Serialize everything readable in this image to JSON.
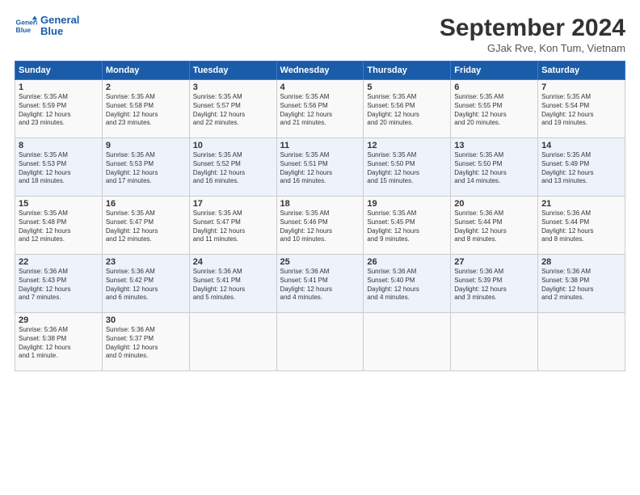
{
  "header": {
    "logo_line1": "General",
    "logo_line2": "Blue",
    "title": "September 2024",
    "subtitle": "GJak Rve, Kon Tum, Vietnam"
  },
  "days_of_week": [
    "Sunday",
    "Monday",
    "Tuesday",
    "Wednesday",
    "Thursday",
    "Friday",
    "Saturday"
  ],
  "weeks": [
    [
      {
        "day": "1",
        "lines": [
          "Sunrise: 5:35 AM",
          "Sunset: 5:59 PM",
          "Daylight: 12 hours",
          "and 23 minutes."
        ]
      },
      {
        "day": "2",
        "lines": [
          "Sunrise: 5:35 AM",
          "Sunset: 5:58 PM",
          "Daylight: 12 hours",
          "and 23 minutes."
        ]
      },
      {
        "day": "3",
        "lines": [
          "Sunrise: 5:35 AM",
          "Sunset: 5:57 PM",
          "Daylight: 12 hours",
          "and 22 minutes."
        ]
      },
      {
        "day": "4",
        "lines": [
          "Sunrise: 5:35 AM",
          "Sunset: 5:56 PM",
          "Daylight: 12 hours",
          "and 21 minutes."
        ]
      },
      {
        "day": "5",
        "lines": [
          "Sunrise: 5:35 AM",
          "Sunset: 5:56 PM",
          "Daylight: 12 hours",
          "and 20 minutes."
        ]
      },
      {
        "day": "6",
        "lines": [
          "Sunrise: 5:35 AM",
          "Sunset: 5:55 PM",
          "Daylight: 12 hours",
          "and 20 minutes."
        ]
      },
      {
        "day": "7",
        "lines": [
          "Sunrise: 5:35 AM",
          "Sunset: 5:54 PM",
          "Daylight: 12 hours",
          "and 19 minutes."
        ]
      }
    ],
    [
      {
        "day": "8",
        "lines": [
          "Sunrise: 5:35 AM",
          "Sunset: 5:53 PM",
          "Daylight: 12 hours",
          "and 18 minutes."
        ]
      },
      {
        "day": "9",
        "lines": [
          "Sunrise: 5:35 AM",
          "Sunset: 5:53 PM",
          "Daylight: 12 hours",
          "and 17 minutes."
        ]
      },
      {
        "day": "10",
        "lines": [
          "Sunrise: 5:35 AM",
          "Sunset: 5:52 PM",
          "Daylight: 12 hours",
          "and 16 minutes."
        ]
      },
      {
        "day": "11",
        "lines": [
          "Sunrise: 5:35 AM",
          "Sunset: 5:51 PM",
          "Daylight: 12 hours",
          "and 16 minutes."
        ]
      },
      {
        "day": "12",
        "lines": [
          "Sunrise: 5:35 AM",
          "Sunset: 5:50 PM",
          "Daylight: 12 hours",
          "and 15 minutes."
        ]
      },
      {
        "day": "13",
        "lines": [
          "Sunrise: 5:35 AM",
          "Sunset: 5:50 PM",
          "Daylight: 12 hours",
          "and 14 minutes."
        ]
      },
      {
        "day": "14",
        "lines": [
          "Sunrise: 5:35 AM",
          "Sunset: 5:49 PM",
          "Daylight: 12 hours",
          "and 13 minutes."
        ]
      }
    ],
    [
      {
        "day": "15",
        "lines": [
          "Sunrise: 5:35 AM",
          "Sunset: 5:48 PM",
          "Daylight: 12 hours",
          "and 12 minutes."
        ]
      },
      {
        "day": "16",
        "lines": [
          "Sunrise: 5:35 AM",
          "Sunset: 5:47 PM",
          "Daylight: 12 hours",
          "and 12 minutes."
        ]
      },
      {
        "day": "17",
        "lines": [
          "Sunrise: 5:35 AM",
          "Sunset: 5:47 PM",
          "Daylight: 12 hours",
          "and 11 minutes."
        ]
      },
      {
        "day": "18",
        "lines": [
          "Sunrise: 5:35 AM",
          "Sunset: 5:46 PM",
          "Daylight: 12 hours",
          "and 10 minutes."
        ]
      },
      {
        "day": "19",
        "lines": [
          "Sunrise: 5:35 AM",
          "Sunset: 5:45 PM",
          "Daylight: 12 hours",
          "and 9 minutes."
        ]
      },
      {
        "day": "20",
        "lines": [
          "Sunrise: 5:36 AM",
          "Sunset: 5:44 PM",
          "Daylight: 12 hours",
          "and 8 minutes."
        ]
      },
      {
        "day": "21",
        "lines": [
          "Sunrise: 5:36 AM",
          "Sunset: 5:44 PM",
          "Daylight: 12 hours",
          "and 8 minutes."
        ]
      }
    ],
    [
      {
        "day": "22",
        "lines": [
          "Sunrise: 5:36 AM",
          "Sunset: 5:43 PM",
          "Daylight: 12 hours",
          "and 7 minutes."
        ]
      },
      {
        "day": "23",
        "lines": [
          "Sunrise: 5:36 AM",
          "Sunset: 5:42 PM",
          "Daylight: 12 hours",
          "and 6 minutes."
        ]
      },
      {
        "day": "24",
        "lines": [
          "Sunrise: 5:36 AM",
          "Sunset: 5:41 PM",
          "Daylight: 12 hours",
          "and 5 minutes."
        ]
      },
      {
        "day": "25",
        "lines": [
          "Sunrise: 5:36 AM",
          "Sunset: 5:41 PM",
          "Daylight: 12 hours",
          "and 4 minutes."
        ]
      },
      {
        "day": "26",
        "lines": [
          "Sunrise: 5:36 AM",
          "Sunset: 5:40 PM",
          "Daylight: 12 hours",
          "and 4 minutes."
        ]
      },
      {
        "day": "27",
        "lines": [
          "Sunrise: 5:36 AM",
          "Sunset: 5:39 PM",
          "Daylight: 12 hours",
          "and 3 minutes."
        ]
      },
      {
        "day": "28",
        "lines": [
          "Sunrise: 5:36 AM",
          "Sunset: 5:38 PM",
          "Daylight: 12 hours",
          "and 2 minutes."
        ]
      }
    ],
    [
      {
        "day": "29",
        "lines": [
          "Sunrise: 5:36 AM",
          "Sunset: 5:38 PM",
          "Daylight: 12 hours",
          "and 1 minute."
        ]
      },
      {
        "day": "30",
        "lines": [
          "Sunrise: 5:36 AM",
          "Sunset: 5:37 PM",
          "Daylight: 12 hours",
          "and 0 minutes."
        ]
      },
      {
        "day": "",
        "lines": []
      },
      {
        "day": "",
        "lines": []
      },
      {
        "day": "",
        "lines": []
      },
      {
        "day": "",
        "lines": []
      },
      {
        "day": "",
        "lines": []
      }
    ]
  ]
}
